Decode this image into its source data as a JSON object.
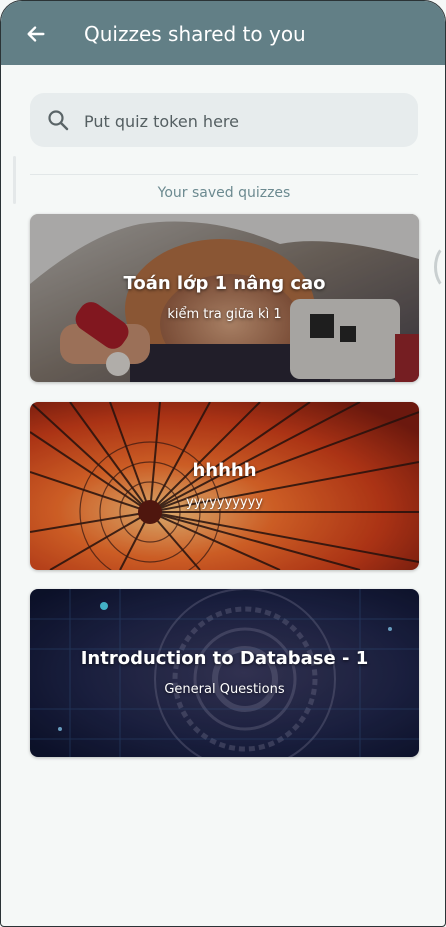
{
  "appbar": {
    "title": "Quizzes shared to you",
    "back_icon": "arrow-left-icon",
    "color": "#627f86"
  },
  "search": {
    "placeholder": "Put quiz token here",
    "value": "",
    "icon": "search-icon"
  },
  "section": {
    "label": "Your saved quizzes"
  },
  "quizzes": [
    {
      "title": "Toán lớp 1 nâng cao",
      "subtitle": "kiểm tra giữa kì 1",
      "image": "child-with-flashlight"
    },
    {
      "title": "hhhhh",
      "subtitle": "yyyyyyyyyy",
      "image": "red-paper-umbrella"
    },
    {
      "title": "Introduction to Database - 1",
      "subtitle": "General Questions",
      "image": "digital-circuit"
    }
  ]
}
